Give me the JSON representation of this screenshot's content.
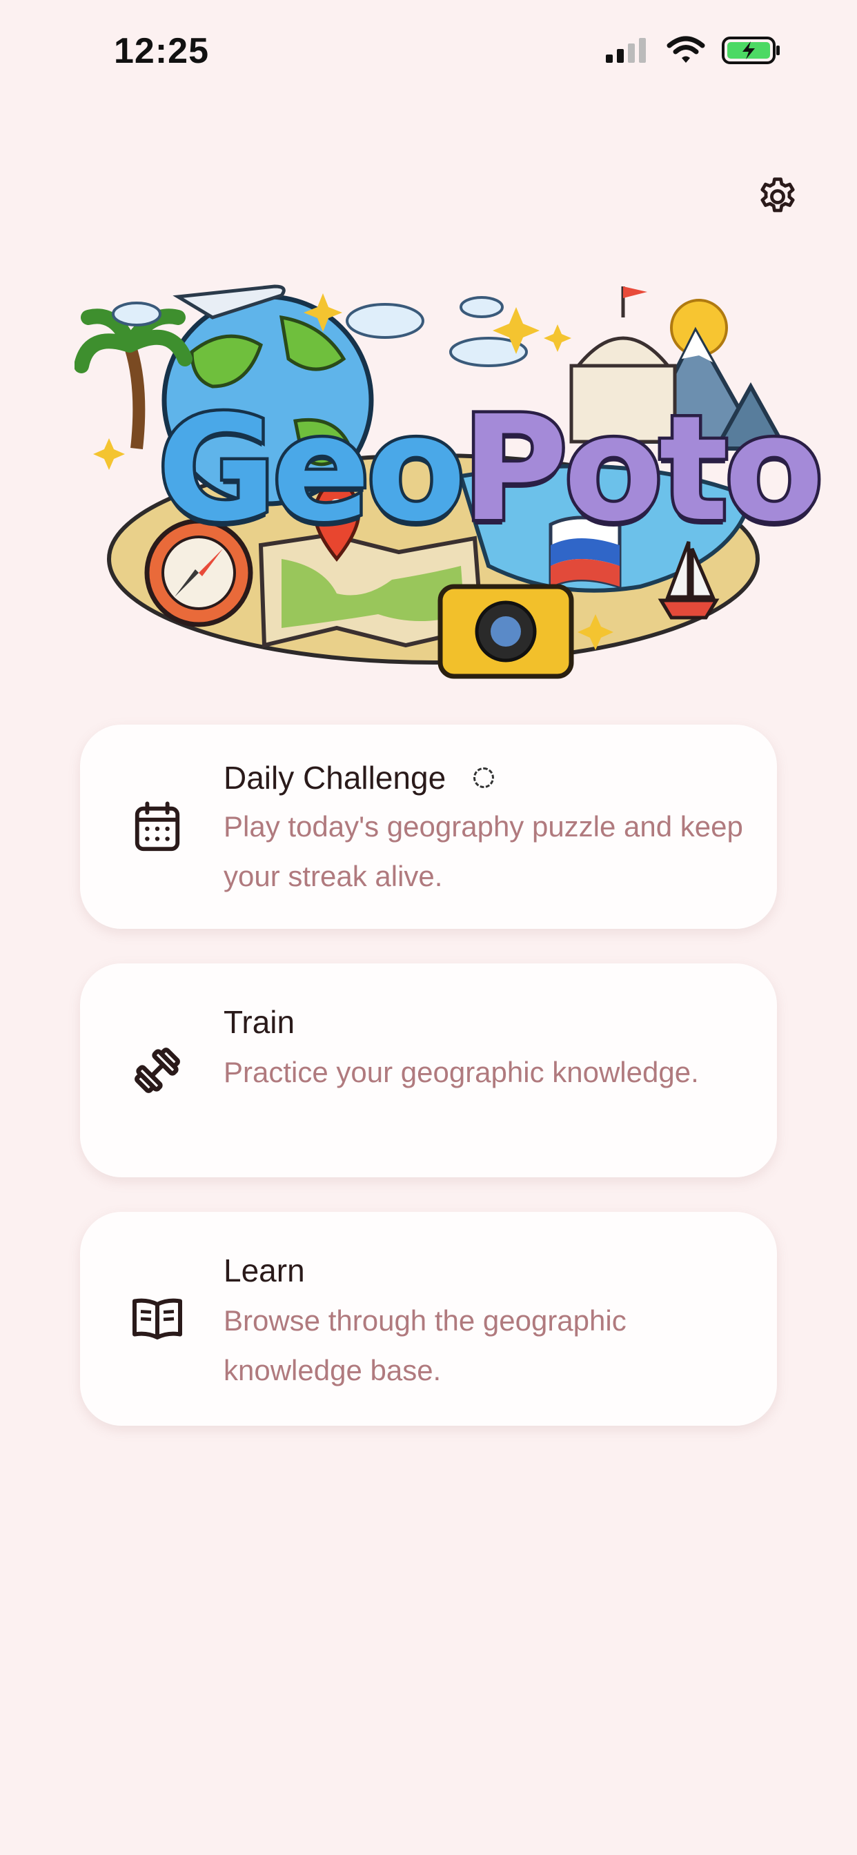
{
  "status_bar": {
    "time": "12:25",
    "icons": [
      "cellular-signal-icon",
      "wifi-icon",
      "battery-charging-icon"
    ],
    "battery_color": "#4cd964"
  },
  "header": {
    "settings_icon": "gear-icon"
  },
  "hero": {
    "logo_part1": "Geo",
    "logo_part2": "Poto"
  },
  "menu": [
    {
      "icon": "calendar-icon",
      "title": "Daily Challenge",
      "description": "Play today's geography puzzle and keep your streak alive.",
      "loading": true
    },
    {
      "icon": "dumbbell-icon",
      "title": "Train",
      "description": "Practice your geographic knowledge."
    },
    {
      "icon": "open-book-icon",
      "title": "Learn",
      "description": "Browse through the geographic knowledge base."
    }
  ],
  "colors": {
    "background": "#fcf1f1",
    "card": "#fffdfd",
    "description_text": "#b07a7e",
    "logo_geo": "#4aa8e8",
    "logo_poto": "#a48ad8"
  }
}
